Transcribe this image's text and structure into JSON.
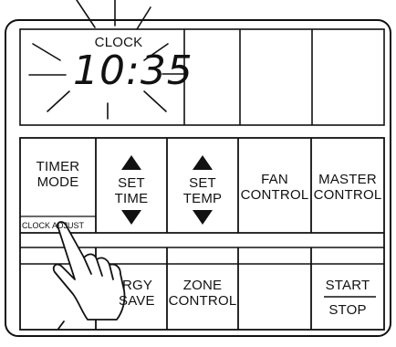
{
  "display": {
    "clock_label": "CLOCK",
    "clock_time": "10:35"
  },
  "buttons": {
    "timer_mode": [
      "TIMER",
      "MODE"
    ],
    "set_time": [
      "SET",
      "TIME"
    ],
    "set_temp": [
      "SET",
      "TEMP"
    ],
    "fan_control": [
      "FAN",
      "CONTROL"
    ],
    "master_control": [
      "MASTER",
      "CONTROL"
    ],
    "clock_adjust": "CLOCK ADJUST",
    "energy_save": [
      "RGY",
      "SAVE"
    ],
    "zone_control": [
      "ZONE",
      "CONTROL"
    ],
    "start": "START",
    "stop": "STOP"
  },
  "icons": {
    "set_up": "up-triangle",
    "set_down": "down-triangle",
    "hand": "pointing-hand"
  }
}
